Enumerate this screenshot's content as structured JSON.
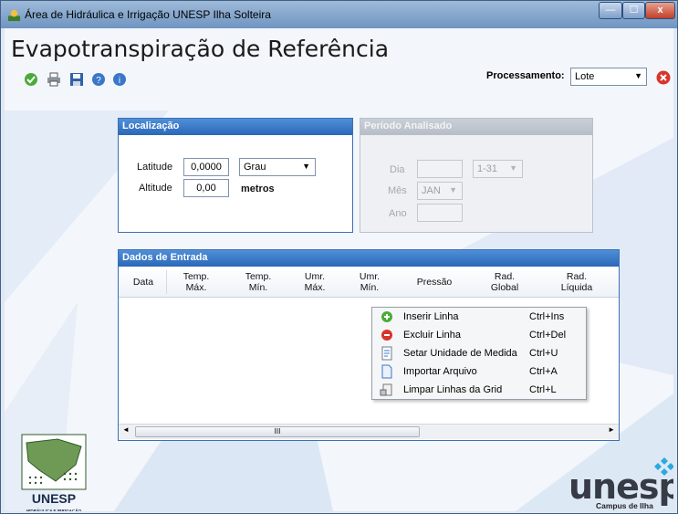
{
  "window": {
    "title": "Área de Hidráulica e Irrigação UNESP Ilha Solteira",
    "controls": {
      "minimize": "—",
      "maximize": "☐",
      "close": "x"
    }
  },
  "app": {
    "heading": "Evapotranspiração de Referência",
    "toolbar_icons": [
      "check-icon",
      "print-icon",
      "save-icon",
      "help-icon",
      "info-icon"
    ],
    "processamento_label": "Processamento:",
    "processamento_value": "Lote"
  },
  "localizacao": {
    "title": "Localização",
    "latitude_label": "Latitude",
    "latitude_value": "0,0000",
    "latitude_unit": "Grau",
    "altitude_label": "Altitude",
    "altitude_value": "0,00",
    "altitude_unit": "metros"
  },
  "periodo": {
    "title": "Período Analisado",
    "dia_label": "Dia",
    "dia_value": "",
    "dia_range": "1-31",
    "mes_label": "Mês",
    "mes_value": "JAN",
    "ano_label": "Ano",
    "ano_value": ""
  },
  "dados": {
    "title": "Dados de Entrada",
    "columns": [
      {
        "line1": "Data",
        "line2": ""
      },
      {
        "line1": "Temp.",
        "line2": "Máx."
      },
      {
        "line1": "Temp.",
        "line2": "Mín."
      },
      {
        "line1": "Umr.",
        "line2": "Máx."
      },
      {
        "line1": "Umr.",
        "line2": "Mín."
      },
      {
        "line1": "Pressão",
        "line2": ""
      },
      {
        "line1": "Rad.",
        "line2": "Global"
      },
      {
        "line1": "Rad.",
        "line2": "Líquida"
      }
    ],
    "scroll_thumb": "III"
  },
  "context_menu": {
    "items": [
      {
        "label": "Inserir Linha",
        "shortcut": "Ctrl+Ins",
        "icon": "add-icon"
      },
      {
        "label": "Excluir Linha",
        "shortcut": "Ctrl+Del",
        "icon": "remove-icon"
      },
      {
        "label": "Setar Unidade de Medida",
        "shortcut": "Ctrl+U",
        "icon": "unit-icon"
      },
      {
        "label": "Importar Arquivo",
        "shortcut": "Ctrl+A",
        "icon": "file-icon"
      },
      {
        "label": "Limpar Linhas da Grid",
        "shortcut": "Ctrl+L",
        "icon": "clear-icon"
      }
    ]
  },
  "branding": {
    "left_logo_text": "UNESP",
    "left_logo_sub": "HIDRÁULICA E IRRIGAÇÃO ILHA SOLTEIRA - SP",
    "right_logo_text": "unesp",
    "right_logo_sub": "Campus de Ilha Solteira"
  }
}
